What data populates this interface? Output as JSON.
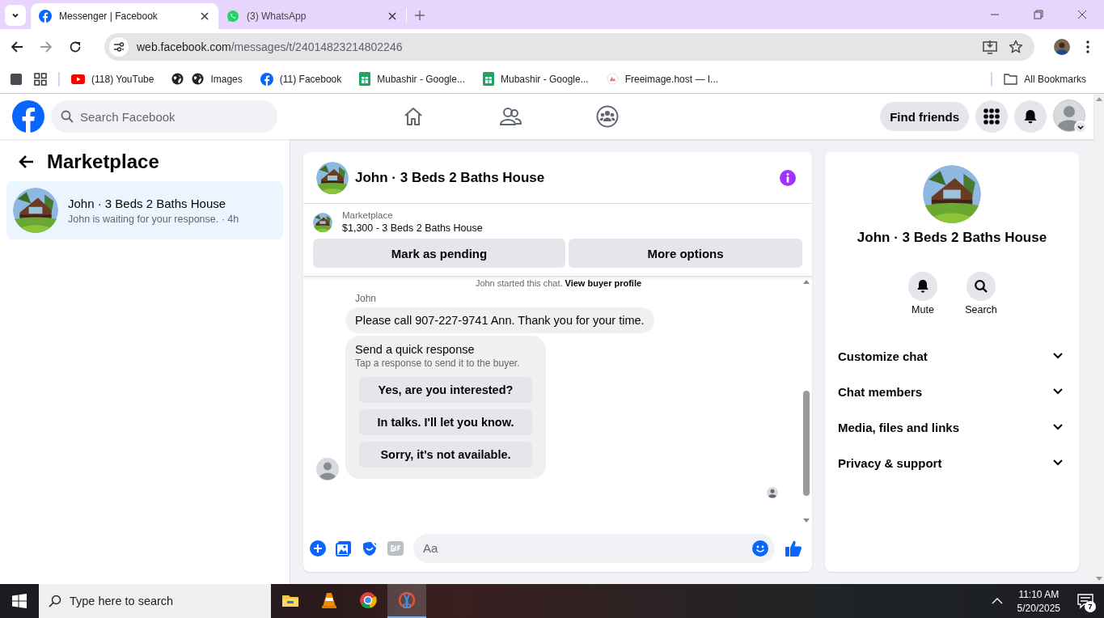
{
  "browser": {
    "tabs": [
      {
        "title": "Messenger | Facebook",
        "kind": "facebook",
        "selected": true
      },
      {
        "title": "(3) WhatsApp",
        "kind": "whatsapp",
        "selected": false
      }
    ],
    "url_host": "web.facebook.com",
    "url_path": "/messages/t/24014823214802246",
    "bookmarks": [
      {
        "kind": "apps"
      },
      {
        "label": "(118) YouTube",
        "kind": "youtube"
      },
      {
        "kind": "globe"
      },
      {
        "label": "Images",
        "kind": "globe"
      },
      {
        "label": "(11) Facebook",
        "kind": "facebook"
      },
      {
        "label": "Mubashir - Google...",
        "kind": "sheets"
      },
      {
        "label": "Mubashir - Google...",
        "kind": "sheets"
      },
      {
        "label": "Freeimage.host — I...",
        "kind": "freeimage"
      }
    ],
    "all_bookmarks": "All Bookmarks"
  },
  "facebook_nav": {
    "search": {
      "placeholder": "Search Facebook"
    },
    "nav_icons": [
      {
        "kind": "home"
      },
      {
        "kind": "friends"
      },
      {
        "kind": "groups"
      }
    ],
    "find_friends": "Find friends"
  },
  "sidebar": {
    "title": "Marketplace",
    "conversations": [
      {
        "title": "John · 3 Beds 2 Baths House",
        "preview": "John is waiting for your response. · 4h",
        "selected": true
      }
    ]
  },
  "chat": {
    "title": "John · 3 Beds 2 Baths House",
    "listing": {
      "label": "Marketplace",
      "price_title": "$1,300 - 3 Beds 2 Baths House"
    },
    "buttons": [
      "Mark as pending",
      "More options"
    ],
    "notice": {
      "text": "John started this chat.",
      "link": "View buyer profile"
    },
    "sender": "John",
    "message": "Please call 907-227-9741 Ann. Thank you for your time.",
    "quick_response": {
      "title": "Send a quick response",
      "subtitle": "Tap a response to send it to the buyer.",
      "options": [
        "Yes, are you interested?",
        "In talks. I'll let you know.",
        "Sorry, it's not available."
      ]
    },
    "composer": {
      "placeholder": "Aa"
    }
  },
  "details": {
    "name": "John · 3 Beds 2 Baths House",
    "actions": [
      {
        "label": "Mute",
        "kind": "bell"
      },
      {
        "label": "Search",
        "kind": "search"
      }
    ],
    "sections": [
      {
        "label": "Customize chat",
        "expanded": false
      },
      {
        "label": "Chat members",
        "expanded": false
      },
      {
        "label": "Media, files and links",
        "expanded": false
      },
      {
        "label": "Privacy & support",
        "expanded": false
      }
    ]
  },
  "taskbar": {
    "search": {
      "placeholder": "Type here to search"
    },
    "apps": [
      {
        "kind": "explorer",
        "selected": false
      },
      {
        "kind": "vlc",
        "selected": false
      },
      {
        "kind": "chrome",
        "selected": false
      },
      {
        "kind": "snip",
        "selected": true
      }
    ],
    "time": "11:10 AM",
    "date": "5/20/2025",
    "notifications": "7"
  }
}
